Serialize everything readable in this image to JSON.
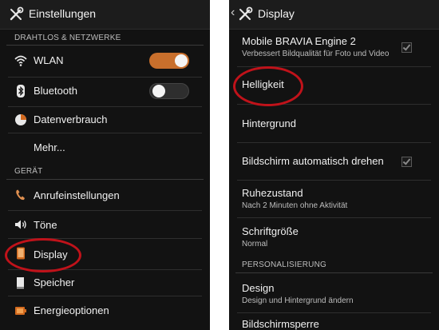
{
  "left_panel": {
    "title": "Einstellungen",
    "sections": {
      "wireless": "DRAHTLOS & NETZWERKE",
      "device": "GERÄT"
    },
    "items": {
      "wlan": "WLAN",
      "bluetooth": "Bluetooth",
      "datenverbrauch": "Datenverbrauch",
      "mehr": "Mehr...",
      "anrufe": "Anrufeinstellungen",
      "toene": "Töne",
      "display": "Display",
      "speicher": "Speicher",
      "energie": "Energieoptionen"
    },
    "toggles": {
      "wlan": "on",
      "bluetooth": "off"
    },
    "icons": {
      "title": "wrench-screwdriver-icon",
      "wlan": "wifi-icon",
      "bluetooth": "bluetooth-icon",
      "datenverbrauch": "data-usage-icon",
      "anrufe": "phone-icon",
      "toene": "speaker-icon",
      "display": "display-icon",
      "speicher": "storage-icon",
      "energie": "battery-icon"
    }
  },
  "right_panel": {
    "title": "Display",
    "sections": {
      "personalisierung": "PERSONALISIERUNG"
    },
    "items": {
      "bravia": {
        "title": "Mobile BRAVIA Engine 2",
        "subtitle": "Verbessert Bildqualität für Foto und Video",
        "checked": true
      },
      "helligkeit": {
        "title": "Helligkeit"
      },
      "hintergrund": {
        "title": "Hintergrund"
      },
      "autorotate": {
        "title": "Bildschirm automatisch drehen",
        "checked": true
      },
      "ruhezustand": {
        "title": "Ruhezustand",
        "subtitle": "Nach 2 Minuten ohne Aktivität"
      },
      "schriftgroesse": {
        "title": "Schriftgröße",
        "subtitle": "Normal"
      },
      "design": {
        "title": "Design",
        "subtitle": "Design und Hintergrund ändern"
      },
      "bildschirmsperre": {
        "title": "Bildschirmsperre"
      }
    }
  },
  "colors": {
    "background": "#121212",
    "toggle_on": "#c86f2c",
    "highlight_circle": "#c0121a"
  }
}
